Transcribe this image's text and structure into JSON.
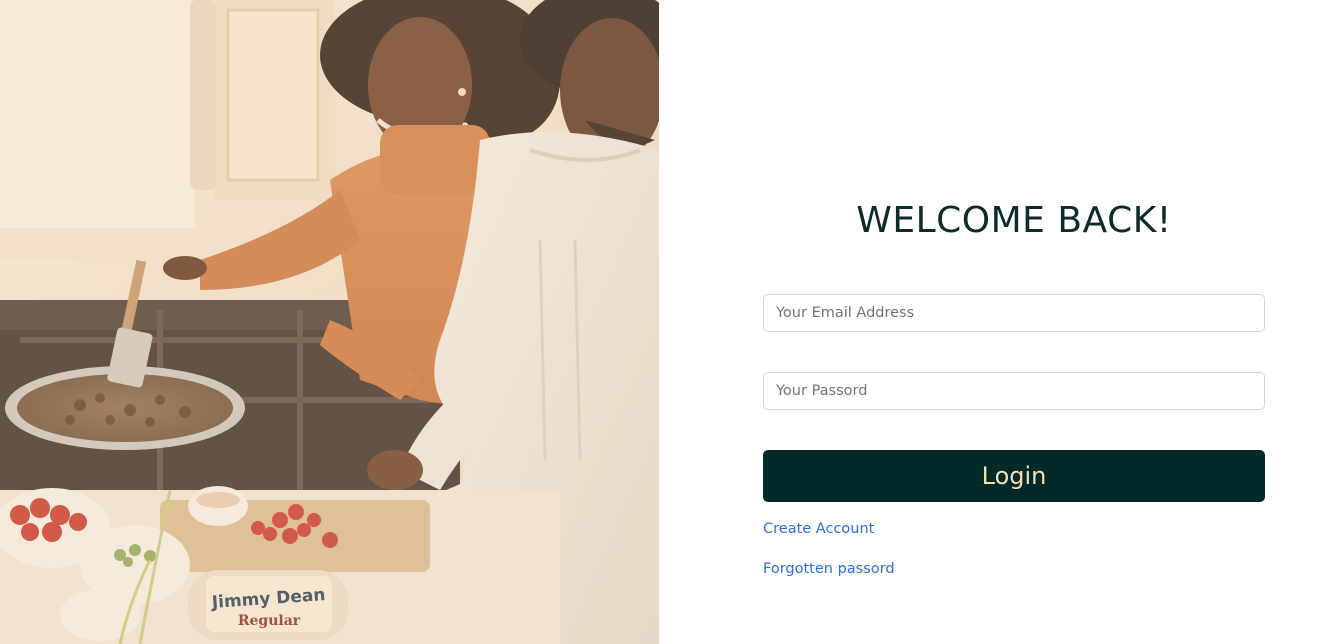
{
  "login": {
    "title": "WELCOME BACK!",
    "email_placeholder": "Your Email Address",
    "password_placeholder": "Your Passord",
    "login_label": "Login",
    "create_account_label": "Create Account",
    "forgot_password_label": "Forgotten passord"
  },
  "hero": {
    "package_brand": "Jimmy Dean",
    "package_variant": "Regular"
  },
  "colors": {
    "button_bg": "#012a28",
    "button_text": "#f6dfae",
    "title": "#0d2b2a",
    "link": "#2a6fdb"
  }
}
